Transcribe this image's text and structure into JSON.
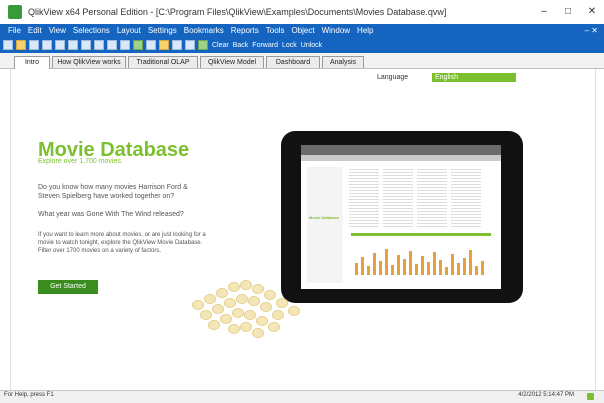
{
  "window": {
    "title": "QlikView x64 Personal Edition - [C:\\Program Files\\QlikView\\Examples\\Documents\\Movies Database.qvw]"
  },
  "window_controls": [
    "–",
    "□",
    "✕"
  ],
  "menu": {
    "items": [
      "File",
      "Edit",
      "View",
      "Selections",
      "Layout",
      "Settings",
      "Bookmarks",
      "Reports",
      "Tools",
      "Object",
      "Window",
      "Help"
    ],
    "mdi": "– ✕"
  },
  "toolbar": {
    "clear": "Clear",
    "back": "Back",
    "forward": "Forward",
    "lock": "Lock",
    "unlock": "Unlock"
  },
  "tabs": [
    "Intro",
    "How QlikView works",
    "Traditional OLAP",
    "QlikView Model",
    "Dashboard",
    "Analysis"
  ],
  "language": {
    "label": "Language",
    "value": "English"
  },
  "hero": {
    "title": "Movie Database",
    "subtitle": "Explore over 1,700 movies.",
    "q1": "Do you know how many movies Harrison Ford & Steven Spielberg have worked together on?",
    "q2": "What year was Gone With The Wind released?",
    "desc": "If you want to learn more about movies, or are just looking for a movie to watch tonight, explore the QlikView Movie Database. Filter over 1700 movies on a variety of factors.",
    "cta": "Get Started"
  },
  "tablet_screen": {
    "title": "Movie Database"
  },
  "status": {
    "left": "For Help, press F1",
    "right": "4/2/2012 5:14:47 PM"
  },
  "colors": {
    "accent_green": "#7cbf2f",
    "brand_blue": "#1565c0",
    "button_green": "#3a8c1e"
  }
}
